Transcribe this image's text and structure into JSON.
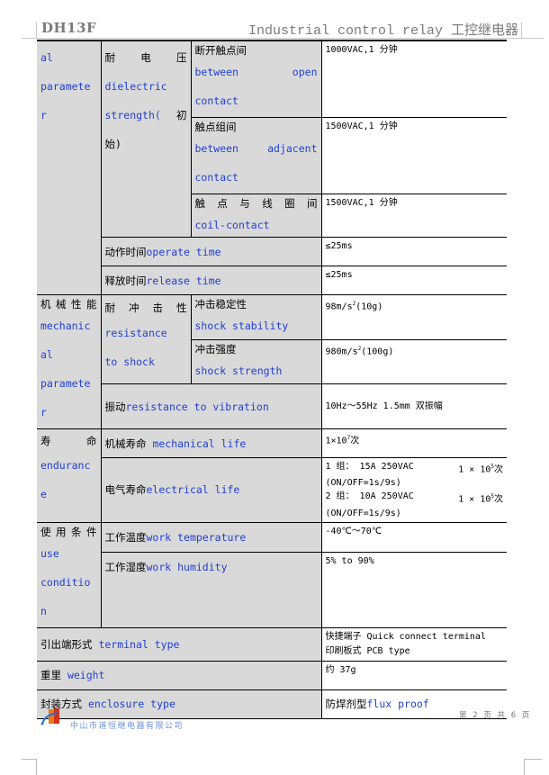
{
  "header": {
    "model": "DH13F",
    "title": "Industrial control relay 工控继电器"
  },
  "table": {
    "electrical_group": {
      "label_en_tail": [
        "al",
        "paramete",
        "r"
      ],
      "dielectric": {
        "label_cn": "耐 电 压",
        "label_en": [
          "dielectric",
          "strength(",
          "初"
        ],
        "label_cn_tail": "始)",
        "rows": [
          {
            "cn": "断开触点间",
            "en": "between open contact",
            "value": "1000VAC,1 分钟"
          },
          {
            "cn": "触点组间",
            "en": "between adjacent contact",
            "value": "1500VAC,1 分钟"
          },
          {
            "cn": "触 点 与 线 圈 间",
            "en": "coil-contact",
            "value": "1500VAC,1 分钟"
          }
        ]
      },
      "operate_time": {
        "cn": "动作时间",
        "en": "operate time",
        "value": "≤25ms"
      },
      "release_time": {
        "cn": "释放时间",
        "en": "release time",
        "value": "≤25ms"
      }
    },
    "mechanical_group": {
      "label_cn": "机械性能",
      "label_en": [
        "mechanic",
        "al",
        "paramete",
        "r"
      ],
      "shock": {
        "label_cn": "耐 冲 击 性",
        "label_en": [
          "resistance",
          "to shock"
        ],
        "rows": [
          {
            "cn": "冲击稳定性",
            "en": "shock stability",
            "value_base": "98m/s",
            "value_sup": "2",
            "value_tail": "(10g)"
          },
          {
            "cn": "冲击强度",
            "en": "shock strength",
            "value_base": "980m/s",
            "value_sup": "2",
            "value_tail": "(100g)"
          }
        ]
      },
      "vibration": {
        "cn": "振动",
        "en": "resistance to vibration",
        "value": "10Hz～55Hz  1.5mm  双振幅"
      }
    },
    "endurance_group": {
      "label_cn": "寿 命",
      "label_en": [
        "enduranc",
        "e"
      ],
      "mechanical_life": {
        "cn": "机械寿命",
        "en": "mechanical life",
        "value_base": "1×10",
        "value_sup": "7",
        "value_tail": "次"
      },
      "electrical_life": {
        "cn": "电气寿命",
        "en": "electrical life",
        "lines": [
          {
            "spec": "1 组： 15A  250VAC",
            "count_base": "1 × 10",
            "count_sup": "5",
            "count_tail": "次",
            "cycle": "(ON/OFF=1s/9s)"
          },
          {
            "spec": "2 组： 10A  250VAC",
            "count_base": "1 × 10",
            "count_sup": "5",
            "count_tail": "次",
            "cycle": "(ON/OFF=1s/9s)"
          }
        ]
      }
    },
    "condition_group": {
      "label_cn": "使用条件",
      "label_en": [
        "use",
        "conditio",
        "n"
      ],
      "temperature": {
        "cn": "工作温度",
        "en": "work temperature",
        "value": "-40℃～70℃"
      },
      "humidity": {
        "cn": "工作湿度",
        "en": "work humidity",
        "value": "5% to 90%"
      }
    },
    "terminal": {
      "cn": "引出端形式",
      "en": "terminal type",
      "value_lines": [
        "快捷端子 Quick connect terminal",
        "印刷板式 PCB type"
      ]
    },
    "weight": {
      "cn": "重里",
      "en": "weight",
      "value": "约 37g"
    },
    "enclosure": {
      "cn": "封装方式",
      "en": "enclosure type",
      "value_cn": "防焊剂型",
      "value_en": "flux proof"
    }
  },
  "footer": {
    "company": "中山市道恒继电器有限公司",
    "page_info": "第 2 页 共 6 页"
  },
  "colors": {
    "english_text": "#1f3fd6",
    "label_cell_bg": "#d9d9d9",
    "header_text": "#7a7a7a"
  }
}
